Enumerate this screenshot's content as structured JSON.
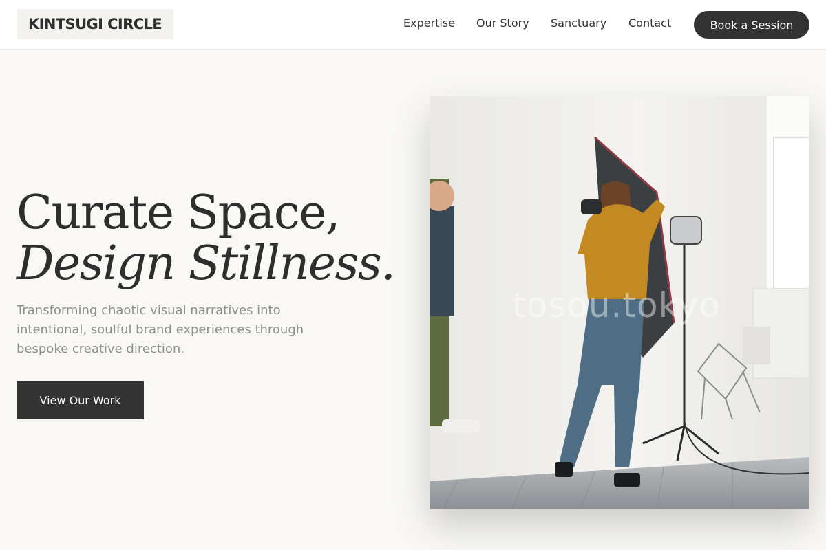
{
  "brand": {
    "name": "KINTSUGI CIRCLE"
  },
  "nav": {
    "items": [
      {
        "label": "Expertise"
      },
      {
        "label": "Our Story"
      },
      {
        "label": "Sanctuary"
      },
      {
        "label": "Contact"
      }
    ],
    "cta_label": "Book a Session"
  },
  "hero": {
    "title_line1": "Curate Space,",
    "title_line2": "Design Stillness.",
    "subtitle": "Transforming chaotic visual narratives into intentional, soulful brand experiences through bespoke creative direction.",
    "button_label": "View Our Work",
    "image": {
      "watermark": "tosou.tokyo",
      "description_icon": "photo-studio-image"
    }
  },
  "colors": {
    "background": "#f9f8f5",
    "header_bg": "#ffffff",
    "primary_dark": "#333333",
    "muted_text": "#8f8f8f"
  }
}
